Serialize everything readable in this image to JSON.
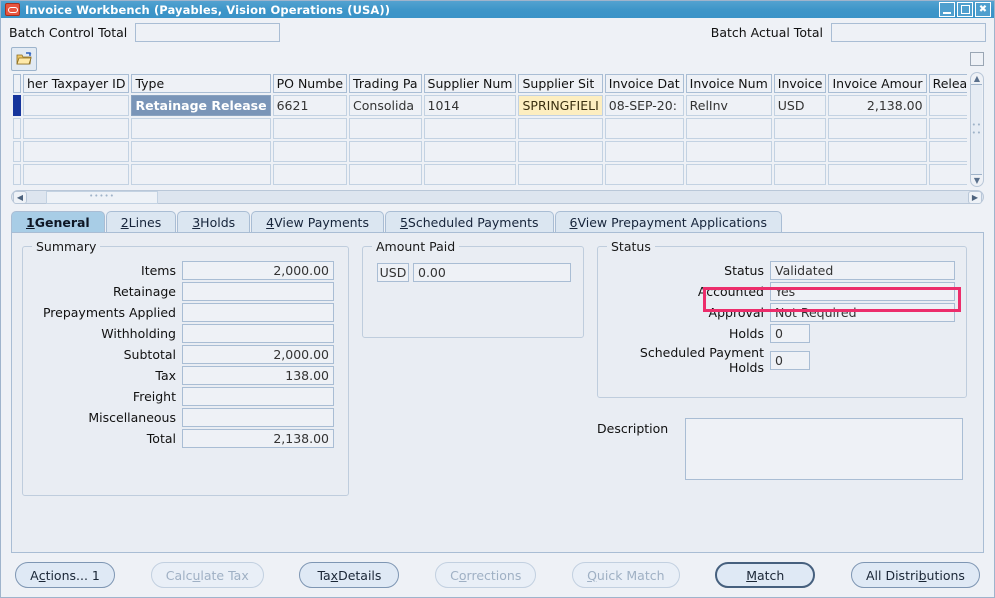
{
  "window": {
    "title": "Invoice Workbench (Payables, Vision Operations (USA))",
    "icon": "oracle-form-icon",
    "minimize_label": "",
    "maximize_label": "",
    "close_label": "✖"
  },
  "header": {
    "batch_control_total_label": "Batch Control Total",
    "batch_control_total_value": "",
    "batch_actual_total_label": "Batch Actual Total",
    "batch_actual_total_value": ""
  },
  "toolbar": {
    "folder_icon": "open-folder-icon",
    "checkbox_checked": false
  },
  "grid": {
    "columns": [
      "her Taxpayer ID",
      "Type",
      "PO Numbe",
      "Trading Pa",
      "Supplier Num",
      "Supplier Sit",
      "Invoice Dat",
      "Invoice Num",
      "Invoice",
      "Invoice Amour",
      "Release Amo"
    ],
    "rows": [
      {
        "selected": true,
        "cells": [
          "",
          "Retainage Release",
          "6621",
          "Consolida",
          "1014",
          "SPRINGFIELI",
          "08-SEP-20:",
          "RelInv",
          "USD",
          "2,138.00",
          ""
        ]
      },
      {
        "selected": false,
        "cells": [
          "",
          "",
          "",
          "",
          "",
          "",
          "",
          "",
          "",
          "",
          ""
        ]
      },
      {
        "selected": false,
        "cells": [
          "",
          "",
          "",
          "",
          "",
          "",
          "",
          "",
          "",
          "",
          ""
        ]
      },
      {
        "selected": false,
        "cells": [
          "",
          "",
          "",
          "",
          "",
          "",
          "",
          "",
          "",
          "",
          ""
        ]
      }
    ],
    "scroll_up_icon": "triangle-up-icon",
    "scroll_down_icon": "triangle-down-icon",
    "scroll_left_icon": "triangle-left-icon",
    "scroll_right_icon": "triangle-right-icon"
  },
  "tabs": [
    {
      "num": "1",
      "label": " General",
      "active": true
    },
    {
      "num": "2",
      "label": " Lines",
      "active": false
    },
    {
      "num": "3",
      "label": " Holds",
      "active": false
    },
    {
      "num": "4",
      "label": " View Payments",
      "active": false
    },
    {
      "num": "5",
      "label": " Scheduled Payments",
      "active": false
    },
    {
      "num": "6",
      "label": " View Prepayment Applications",
      "active": false
    }
  ],
  "summary": {
    "legend": "Summary",
    "fields": [
      {
        "label": "Items",
        "value": "2,000.00"
      },
      {
        "label": "Retainage",
        "value": ""
      },
      {
        "label": "Prepayments Applied",
        "value": ""
      },
      {
        "label": "Withholding",
        "value": ""
      },
      {
        "label": "Subtotal",
        "value": "2,000.00"
      },
      {
        "label": "Tax",
        "value": "138.00"
      },
      {
        "label": "Freight",
        "value": ""
      },
      {
        "label": "Miscellaneous",
        "value": ""
      },
      {
        "label": "Total",
        "value": "2,138.00"
      }
    ]
  },
  "amount_paid": {
    "legend": "Amount Paid",
    "currency": "USD",
    "value": "0.00"
  },
  "status": {
    "legend": "Status",
    "fields": [
      {
        "label": "Status",
        "value": "Validated"
      },
      {
        "label": "Accounted",
        "value": "Yes"
      },
      {
        "label": "Approval",
        "value": "Not Required"
      },
      {
        "label": "Holds",
        "value": "0"
      },
      {
        "label": "Scheduled Payment Holds",
        "value": "0"
      }
    ],
    "highlight_color": "#ec2d6b",
    "highlighted_field": "Accounted"
  },
  "description": {
    "label": "Description",
    "value": ""
  },
  "buttons": [
    {
      "pre": "A",
      "mnemonic": "c",
      "post": "tions... 1",
      "state": "enabled"
    },
    {
      "pre": "Calc",
      "mnemonic": "u",
      "post": "late Tax",
      "state": "disabled"
    },
    {
      "pre": "Ta",
      "mnemonic": "x",
      "post": " Details",
      "state": "enabled"
    },
    {
      "pre": "C",
      "mnemonic": "o",
      "post": "rrections",
      "state": "disabled"
    },
    {
      "pre": "",
      "mnemonic": "Q",
      "post": "uick Match",
      "state": "disabled"
    },
    {
      "pre": "",
      "mnemonic": "M",
      "post": "atch",
      "state": "default"
    },
    {
      "pre": "All Distri",
      "mnemonic": "b",
      "post": "utions",
      "state": "enabled"
    }
  ]
}
